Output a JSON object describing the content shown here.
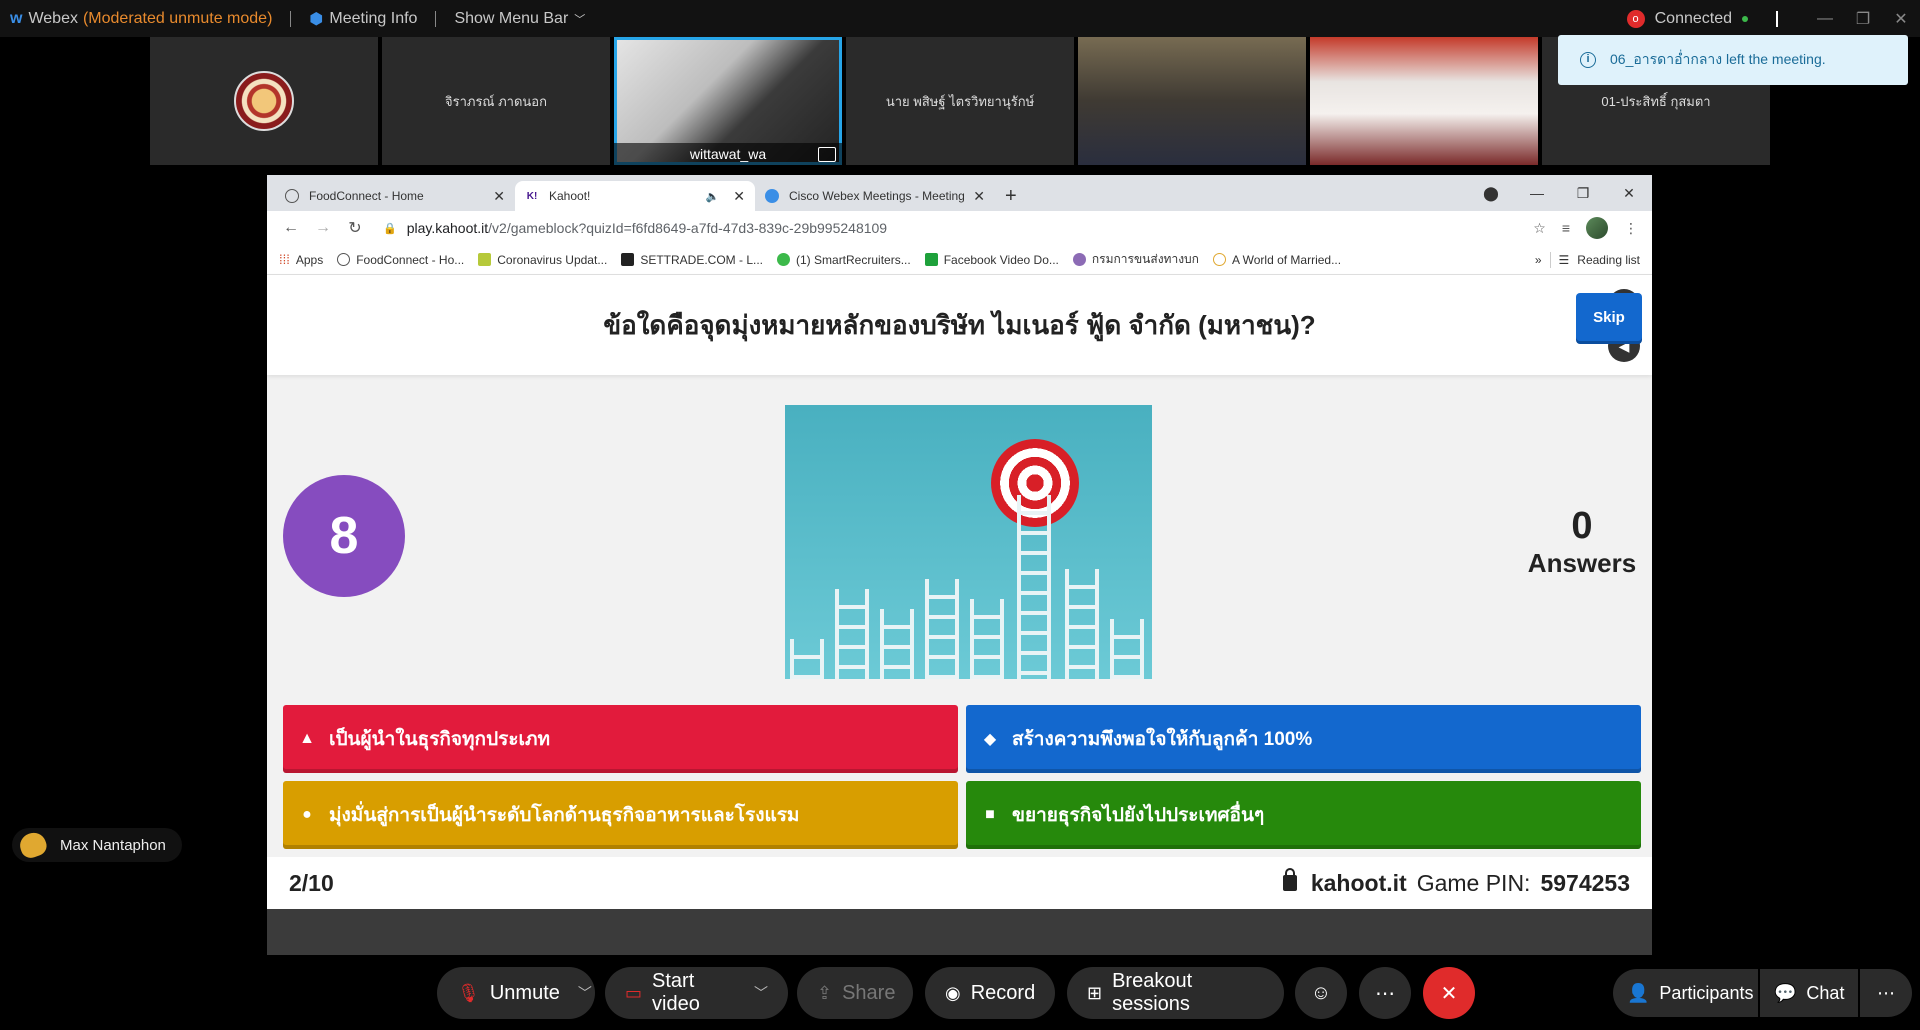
{
  "topbar": {
    "app": "Webex",
    "mode": "(Moderated unmute mode)",
    "meeting_info": "Meeting Info",
    "show_menu_bar": "Show Menu Bar",
    "status": "Connected"
  },
  "participants": [
    {
      "name": ""
    },
    {
      "name": "จิราภรณ์ ภาดนอก"
    },
    {
      "name": "wittawat_wa"
    },
    {
      "name": "นาย พสิษฐ์ ไตรวิทยานุรักษ์"
    },
    {
      "name": ""
    },
    {
      "name": ""
    },
    {
      "name": "01-ประสิทธิ์ กุสมตา"
    }
  ],
  "notification": "06_อารดาอ่ำกลาง left the meeting.",
  "reaction_user": "Max Nantaphon",
  "browser": {
    "tabs": [
      {
        "title": "FoodConnect - Home"
      },
      {
        "title": "Kahoot!"
      },
      {
        "title": "Cisco Webex Meetings - Meeting"
      }
    ],
    "url_host": "play.kahoot.it",
    "url_path": "/v2/gameblock?quizId=f6fd8649-a7fd-47d3-839c-29b995248109",
    "bookmarks": [
      "Apps",
      "FoodConnect - Ho...",
      "Coronavirus Updat...",
      "SETTRADE.COM - L...",
      "(1) SmartRecruiters...",
      "Facebook Video Do...",
      "กรมการขนส่งทางบก",
      "A World of Married..."
    ],
    "reading_list": "Reading list"
  },
  "kahoot": {
    "question": "ข้อใดคือจุดมุ่งหมายหลักของบริษัท ไมเนอร์ ฟู้ด จำกัด (มหาชน)?",
    "timer": "8",
    "skip": "Skip",
    "answers_count": "0",
    "answers_label": "Answers",
    "options": [
      {
        "text": "เป็นผู้นำในธุรกิจทุกประเภท",
        "color": "#e21b3c",
        "shape": "triangle"
      },
      {
        "text": "สร้างความพึงพอใจให้กับลูกค้า 100%",
        "color": "#1368ce",
        "shape": "diamond"
      },
      {
        "text": "มุ่งมั่นสู่การเป็นผู้นำระดับโลกด้านธุรกิจอาหารและโรงแรม",
        "color": "#d89e00",
        "shape": "circle"
      },
      {
        "text": "ขยายธุรกิจไปยังไปประเทศอื่นๆ",
        "color": "#26890c",
        "shape": "square"
      }
    ],
    "progress": "2/10",
    "site": "kahoot.it",
    "pin_label": "Game PIN:",
    "pin": "5974253"
  },
  "controls": {
    "unmute": "Unmute",
    "start_video": "Start video",
    "share": "Share",
    "record": "Record",
    "breakout": "Breakout sessions",
    "participants": "Participants",
    "chat": "Chat"
  }
}
